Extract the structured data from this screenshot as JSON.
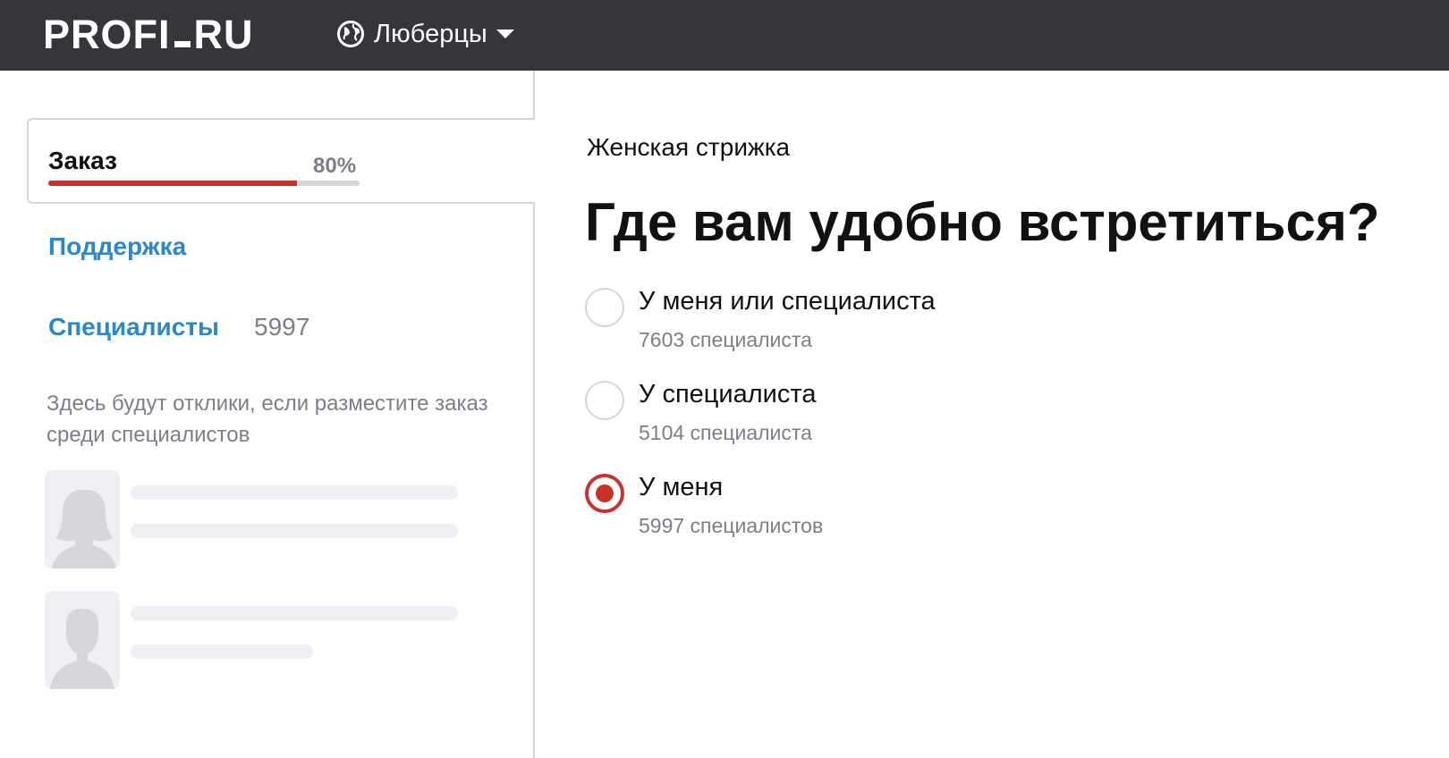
{
  "header": {
    "logo_left": "PROFI",
    "logo_right": "RU",
    "city": "Люберцы"
  },
  "sidebar": {
    "order_title": "Заказ",
    "order_progress_label": "80%",
    "order_progress": 0.8,
    "support_label": "Поддержка",
    "specialists_label": "Специалисты",
    "specialists_count": "5997",
    "hint": "Здесь будут отклики, если разместите заказ среди специалистов"
  },
  "main": {
    "category": "Женская стрижка",
    "question": "Где вам удобно встретиться?",
    "options": [
      {
        "label": "У меня или специалиста",
        "sub": "7603 специалиста",
        "checked": false
      },
      {
        "label": "У специалиста",
        "sub": "5104 специалиста",
        "checked": false
      },
      {
        "label": "У меня",
        "sub": "5997 специалистов",
        "checked": true
      }
    ]
  },
  "colors": {
    "topbar": "#34363b",
    "accent": "#c7332a",
    "link": "#2c88c6",
    "muted": "#7d7f86"
  }
}
